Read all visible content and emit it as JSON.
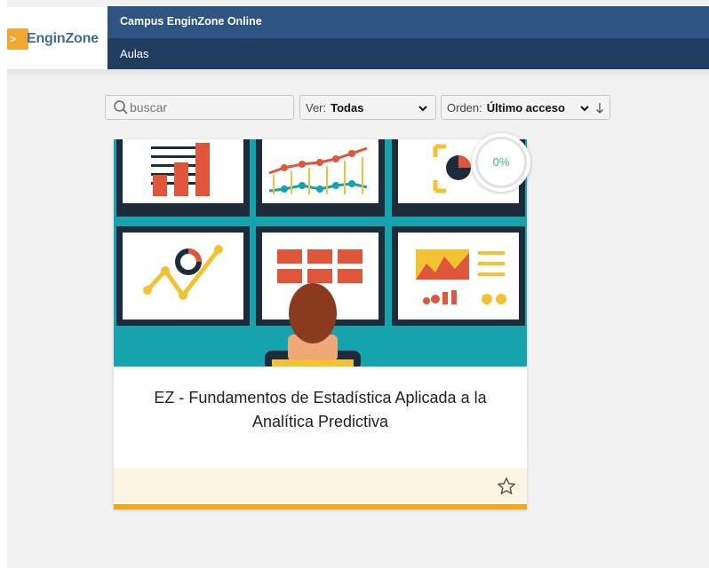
{
  "header": {
    "logo_text": "EnginZone",
    "logo_mark": ">",
    "site_title": "Campus EnginZone Online",
    "nav": [
      {
        "label": "Aulas"
      }
    ]
  },
  "filters": {
    "search_placeholder": "buscar",
    "ver_label": "Ver:",
    "ver_value": "Todas",
    "orden_label": "Orden:",
    "orden_value": "Último acceso",
    "sort_direction_icon": "arrow-down-icon"
  },
  "course": {
    "title": "EZ - Fundamentos de Estadística Aplicada a la Analítica Predictiva",
    "progress_text": "0%",
    "progress": 0,
    "favorite_icon": "star-outline-icon"
  },
  "colors": {
    "topbar": "#2e5482",
    "navbar": "#1f3c61",
    "accent": "#f0a81f",
    "progress_green": "#3dba73",
    "image_teal": "#15a3ad"
  }
}
